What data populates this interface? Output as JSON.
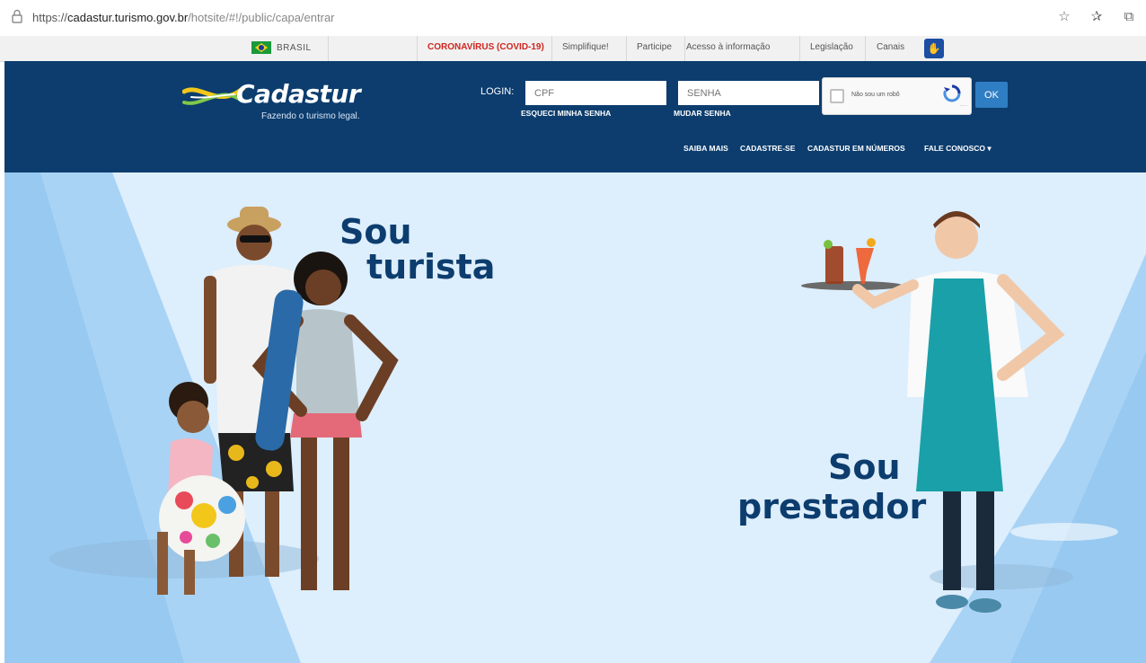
{
  "browser": {
    "url_prefix": "https://",
    "url_host": "cadastur.turismo.gov.br",
    "url_path": "/hotsite/#!/public/capa/entrar"
  },
  "govbar": {
    "country": "BRASIL",
    "links": [
      "CORONAVÍRUS (COVID-19)",
      "Simplifique!",
      "Participe",
      "Acesso à informação",
      "Legislação",
      "Canais"
    ]
  },
  "header": {
    "logo_name": "Cadastur",
    "logo_tagline": "Fazendo o turismo legal.",
    "login_label": "LOGIN:",
    "cpf_placeholder": "CPF",
    "senha_placeholder": "SENHA",
    "forgot_password": "ESQUECI MINHA SENHA",
    "change_password": "MUDAR SENHA",
    "captcha_label": "Não sou um robô",
    "ok_label": "OK",
    "nav": [
      "SAIBA MAIS",
      "CADASTRE-SE",
      "CADASTUR EM NÚMEROS",
      "FALE CONOSCO ▾"
    ]
  },
  "hero": {
    "tourist_line1": "Sou",
    "tourist_line2": "turista",
    "provider_line1": "Sou",
    "provider_line2": "prestador"
  },
  "colors": {
    "header_blue": "#0c3d6e",
    "hero_bg": "#ddeefc",
    "ok_button": "#2f7ec3",
    "covid_red": "#d0261f"
  }
}
